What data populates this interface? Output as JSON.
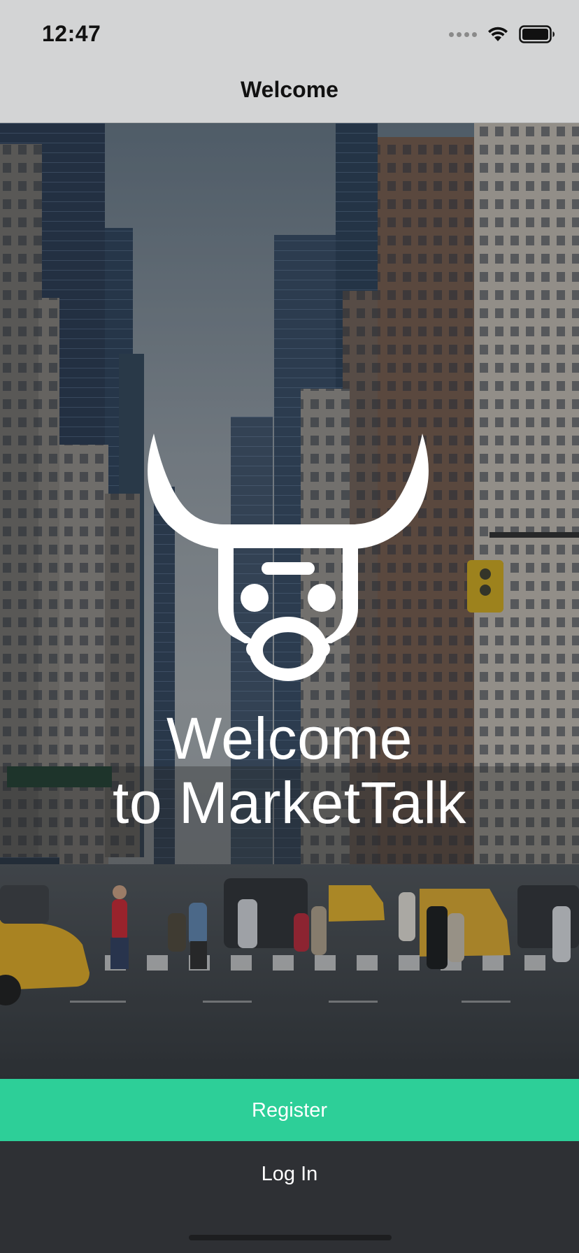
{
  "status_bar": {
    "time": "12:47"
  },
  "nav": {
    "title": "Welcome"
  },
  "hero": {
    "headline_line1": "Welcome",
    "headline_line2": "to MarketTalk",
    "logo_icon": "bull-head-icon"
  },
  "actions": {
    "register_label": "Register",
    "login_label": "Log In"
  },
  "colors": {
    "accent": "#2dcf98",
    "dark": "#2e3034",
    "nav_bg": "#d3d4d5"
  }
}
